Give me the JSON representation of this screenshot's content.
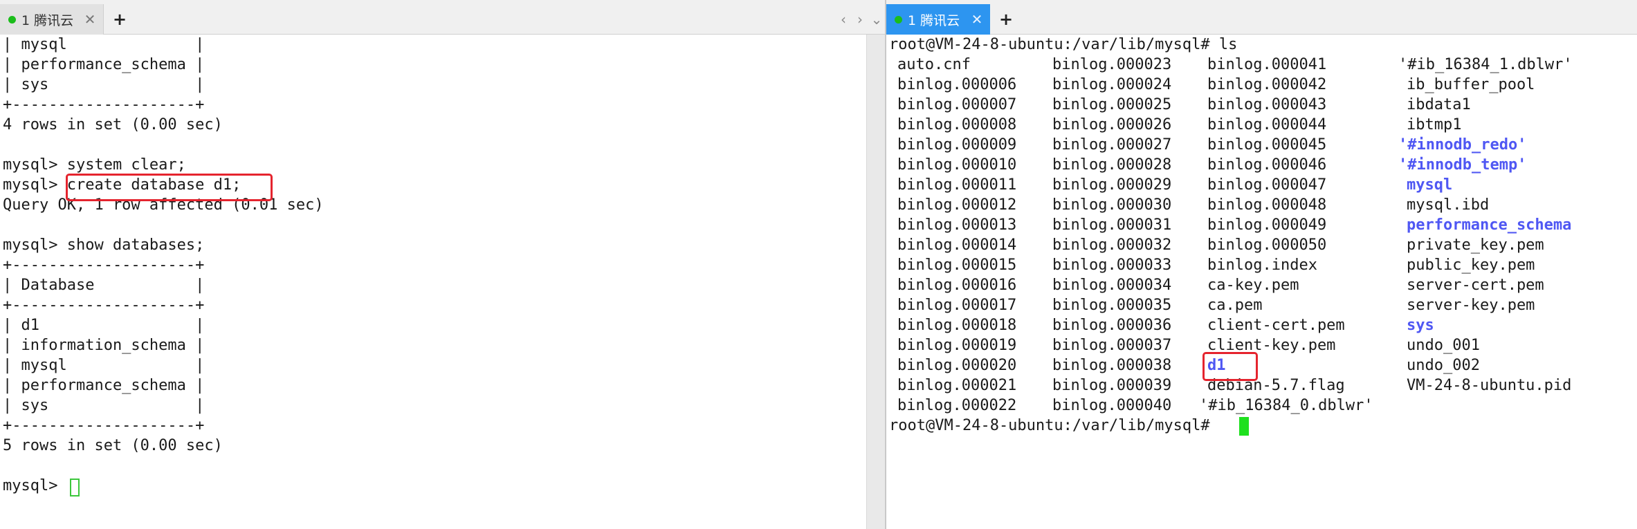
{
  "colors": {
    "active_tab": "#2d95f0",
    "status_dot": "#1bbd1b",
    "highlight_box": "#e5242e",
    "directory": "#4f57f3",
    "cursor": "#1ee01e"
  },
  "left_tab": {
    "title": "1 腾讯云",
    "close": "✕",
    "new_tab": "+"
  },
  "right_tab": {
    "title": "1 腾讯云",
    "close": "✕",
    "new_tab": "+"
  },
  "nav": {
    "prev": "‹",
    "next": "›",
    "menu": "⌄"
  },
  "left_terminal": {
    "lines": [
      "| mysql              |",
      "| performance_schema |",
      "| sys                |",
      "+--------------------+",
      "4 rows in set (0.00 sec)",
      "",
      "mysql> system clear;",
      "mysql> create database d1;",
      "Query OK, 1 row affected (0.01 sec)",
      "",
      "mysql> show databases;",
      "+--------------------+",
      "| Database           |",
      "+--------------------+",
      "| d1                 |",
      "| information_schema |",
      "| mysql              |",
      "| performance_schema |",
      "| sys                |",
      "+--------------------+",
      "5 rows in set (0.00 sec)",
      "",
      "mysql> "
    ]
  },
  "right_terminal": {
    "prompt_command": "root@VM-24-8-ubuntu:/var/lib/mysql# ls",
    "final_prompt": "root@VM-24-8-ubuntu:/var/lib/mysql# ",
    "columns": [
      [
        "auto.cnf",
        "binlog.000006",
        "binlog.000007",
        "binlog.000008",
        "binlog.000009",
        "binlog.000010",
        "binlog.000011",
        "binlog.000012",
        "binlog.000013",
        "binlog.000014",
        "binlog.000015",
        "binlog.000016",
        "binlog.000017",
        "binlog.000018",
        "binlog.000019",
        "binlog.000020",
        "binlog.000021",
        "binlog.000022"
      ],
      [
        "binlog.000023",
        "binlog.000024",
        "binlog.000025",
        "binlog.000026",
        "binlog.000027",
        "binlog.000028",
        "binlog.000029",
        "binlog.000030",
        "binlog.000031",
        "binlog.000032",
        "binlog.000033",
        "binlog.000034",
        "binlog.000035",
        "binlog.000036",
        "binlog.000037",
        "binlog.000038",
        "binlog.000039",
        "binlog.000040"
      ],
      [
        "binlog.000041",
        "binlog.000042",
        "binlog.000043",
        "binlog.000044",
        "binlog.000045",
        "binlog.000046",
        "binlog.000047",
        "binlog.000048",
        "binlog.000049",
        "binlog.000050",
        "binlog.index",
        "ca-key.pem",
        "ca.pem",
        "client-cert.pem",
        "client-key.pem",
        "d1",
        "debian-5.7.flag",
        "'#ib_16384_0.dblwr'"
      ],
      [
        "'#ib_16384_1.dblwr'",
        "ib_buffer_pool",
        "ibdata1",
        "ibtmp1",
        "'#innodb_redo'",
        "'#innodb_temp'",
        "mysql",
        "mysql.ibd",
        "performance_schema",
        "private_key.pem",
        "public_key.pem",
        "server-cert.pem",
        "server-key.pem",
        "sys",
        "undo_001",
        "undo_002",
        "VM-24-8-ubuntu.pid",
        ""
      ]
    ],
    "directories": [
      "d1",
      "'#innodb_redo'",
      "'#innodb_temp'",
      "mysql",
      "performance_schema",
      "sys"
    ]
  }
}
